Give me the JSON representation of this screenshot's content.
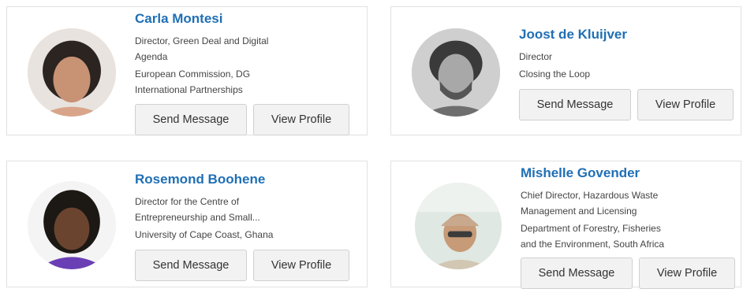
{
  "accent_color": "#1f6fb5",
  "profiles": [
    {
      "name": "Carla Montesi",
      "lines": [
        "Director, Green Deal and Digital",
        "Agenda",
        "European Commission, DG",
        "International Partnerships"
      ],
      "send_label": "Send Message",
      "view_label": "View Profile"
    },
    {
      "name": "Joost de Kluijver",
      "lines": [
        "Director",
        "Closing the Loop"
      ],
      "send_label": "Send Message",
      "view_label": "View Profile"
    },
    {
      "name": "Rosemond Boohene",
      "lines": [
        "Director for the Centre of",
        "Entrepreneurship and Small...",
        "University of Cape Coast, Ghana"
      ],
      "send_label": "Send Message",
      "view_label": "View Profile"
    },
    {
      "name": "Mishelle Govender",
      "lines": [
        "Chief Director, Hazardous Waste",
        "Management and Licensing",
        "Department of Forestry, Fisheries",
        "and the Environment, South Africa"
      ],
      "send_label": "Send Message",
      "view_label": "View Profile"
    }
  ]
}
